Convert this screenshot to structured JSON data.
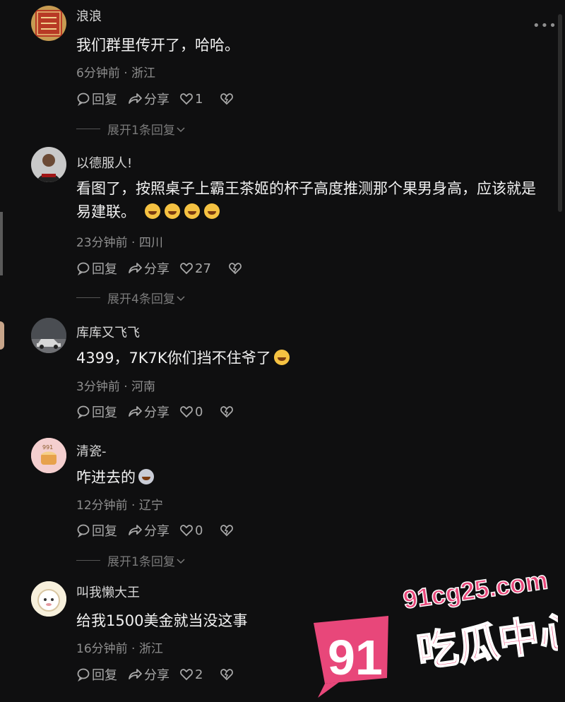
{
  "comments": [
    {
      "username": "浪浪",
      "text": "我们群里传开了，哈哈。",
      "meta": "6分钟前 · 浙江",
      "reply": "回复",
      "share": "分享",
      "likes": "1",
      "expand": "展开1条回复",
      "avatar": "red-seal-avatar"
    },
    {
      "username": "以德服人!",
      "text": "看图了，按照桌子上霸王茶姬的杯子高度推测那个果男身高，应该就是易建联。",
      "meta": "23分钟前 · 四川",
      "reply": "回复",
      "share": "分享",
      "likes": "27",
      "expand": "展开4条回复",
      "avatar": "man-avatar"
    },
    {
      "username": "库库又飞飞",
      "text": "4399，7K7K你们挡不住爷了",
      "meta": "3分钟前 · 河南",
      "reply": "回复",
      "share": "分享",
      "likes": "0",
      "avatar": "car-avatar"
    },
    {
      "username": "清瓷-",
      "text": "咋进去的",
      "meta": "12分钟前 · 辽宁",
      "reply": "回复",
      "share": "分享",
      "likes": "0",
      "expand": "展开1条回复",
      "avatar": "cake-avatar"
    },
    {
      "username": "叫我懒大王",
      "text": "给我1500美金就当没这事",
      "meta": "16分钟前 · 浙江",
      "reply": "回复",
      "share": "分享",
      "likes": "2",
      "avatar": "sheep-avatar"
    }
  ],
  "watermark": {
    "site": "91cg25.com",
    "number": "91",
    "name": "吃瓜中心"
  },
  "colors": {
    "background": "#0f0f10",
    "text": "#f1f1f1",
    "muted": "#8f8f8f",
    "watermark": "#e8477a"
  }
}
